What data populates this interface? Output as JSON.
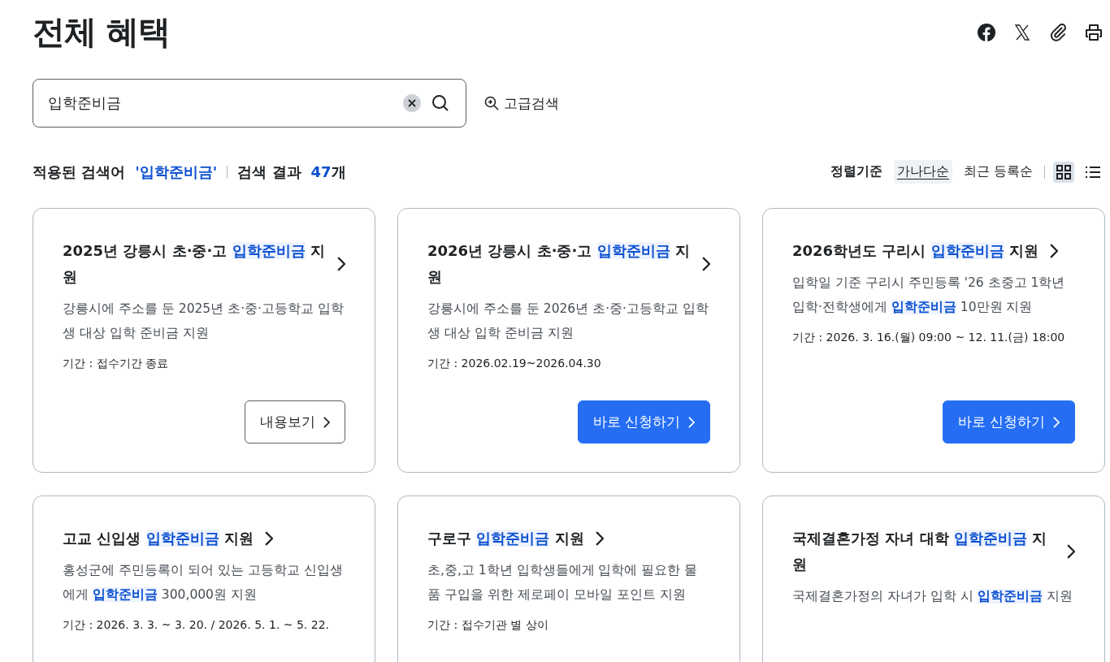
{
  "page_title": "전체 혜택",
  "share_icons": [
    {
      "kind": "facebook"
    },
    {
      "kind": "x"
    },
    {
      "kind": "link"
    },
    {
      "kind": "print"
    }
  ],
  "search": {
    "value": "입학준비금",
    "advanced_label": "고급검색"
  },
  "summary": {
    "applied_label": "적용된 검색어",
    "applied_term": "'입학준비금'",
    "result_label": "검색 결과",
    "count": "47",
    "count_unit": "개"
  },
  "sort": {
    "label": "정렬기준",
    "options": [
      {
        "label": "가나다순",
        "selected": true
      },
      {
        "label": "최근 등록순",
        "selected": false
      }
    ]
  },
  "views": [
    {
      "kind": "grid",
      "selected": true
    },
    {
      "kind": "list",
      "selected": false
    }
  ],
  "cards": [
    {
      "title": [
        {
          "text": "2025년 강릉시 초·중·고 ",
          "highlight": false
        },
        {
          "text": "입학준비금",
          "highlight": true
        },
        {
          "text": " 지원",
          "highlight": false
        }
      ],
      "description": [
        {
          "text": "강릉시에 주소를 둔 2025년 초·중·고등학교 입학생 대상 입학 준비금 지원",
          "highlight": false
        }
      ],
      "period": "기간 : 접수기간 종료",
      "button": {
        "kind": "outline",
        "label": "내용보기"
      }
    },
    {
      "title": [
        {
          "text": "2026년 강릉시 초·중·고 ",
          "highlight": false
        },
        {
          "text": "입학준비금",
          "highlight": true
        },
        {
          "text": " 지원",
          "highlight": false
        }
      ],
      "description": [
        {
          "text": "강릉시에 주소를 둔 2026년 초·중·고등학교 입학생 대상 입학 준비금 지원",
          "highlight": false
        }
      ],
      "period": "기간 : 2026.02.19~2026.04.30",
      "button": {
        "kind": "primary",
        "label": "바로 신청하기"
      }
    },
    {
      "title": [
        {
          "text": "2026학년도 구리시 ",
          "highlight": false
        },
        {
          "text": "입학준비금",
          "highlight": true
        },
        {
          "text": " 지원",
          "highlight": false
        }
      ],
      "description": [
        {
          "text": "입학일 기준 구리시 주민등록 '26 초중고 1학년 입학·전학생에게 ",
          "highlight": false
        },
        {
          "text": "입학준비금",
          "highlight": true
        },
        {
          "text": " 10만원 지원",
          "highlight": false
        }
      ],
      "period": "기간 : 2026. 3. 16.(월) 09:00 ~ 12. 11.(금) 18:00",
      "button": {
        "kind": "primary",
        "label": "바로 신청하기"
      }
    },
    {
      "title": [
        {
          "text": "고교 신입생 ",
          "highlight": false
        },
        {
          "text": "입학준비금",
          "highlight": true
        },
        {
          "text": " 지원",
          "highlight": false
        }
      ],
      "description": [
        {
          "text": "홍성군에 주민등록이 되어 있는 고등학교 신입생에게 ",
          "highlight": false
        },
        {
          "text": "입학준비금",
          "highlight": true
        },
        {
          "text": " 300,000원 지원",
          "highlight": false
        }
      ],
      "period": "기간 : 2026. 3. 3. ~ 3. 20. / 2026. 5. 1. ~ 5. 22."
    },
    {
      "title": [
        {
          "text": "구로구 ",
          "highlight": false
        },
        {
          "text": "입학준비금",
          "highlight": true
        },
        {
          "text": " 지원",
          "highlight": false
        }
      ],
      "description": [
        {
          "text": "초,중,고 1학년 입학생들에게 입학에 필요한 물품 구입을 위한 제로페이 모바일 포인트 지원",
          "highlight": false
        }
      ],
      "period": "기간 : 접수기관 별 상이"
    },
    {
      "title": [
        {
          "text": "국제결혼가정 자녀 대학 ",
          "highlight": false
        },
        {
          "text": "입학준비금",
          "highlight": true
        },
        {
          "text": " 지원",
          "highlight": false
        }
      ],
      "description": [
        {
          "text": "국제결혼가정의 자녀가 입학 시 ",
          "highlight": false
        },
        {
          "text": "입학준비금",
          "highlight": true
        },
        {
          "text": " 지원",
          "highlight": false
        }
      ]
    }
  ]
}
